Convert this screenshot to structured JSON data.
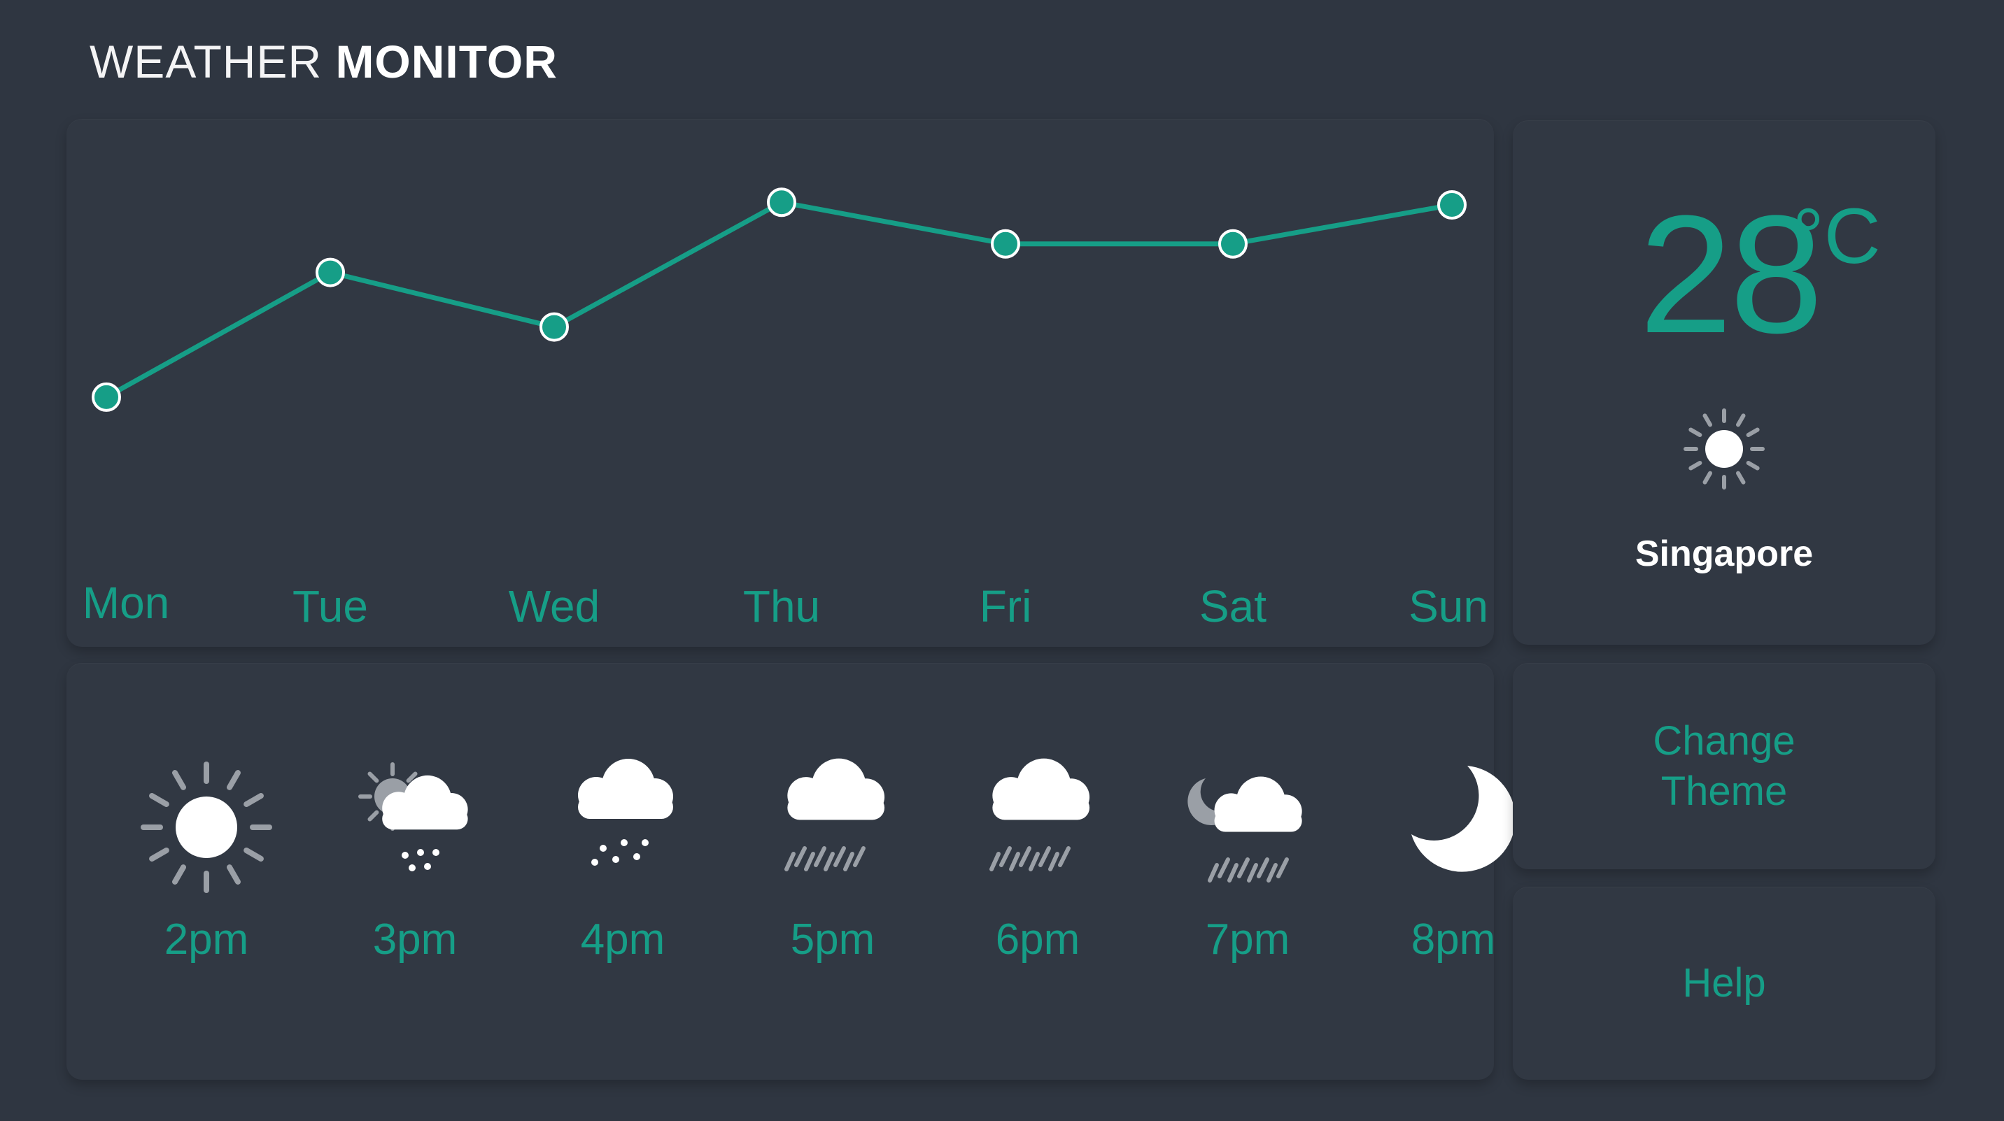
{
  "header": {
    "title_light": "WEATHER",
    "title_bold": "MONITOR"
  },
  "colors": {
    "accent": "#169e87",
    "background": "#2f3641",
    "panel": "#313843",
    "icon_white": "#ffffff",
    "icon_grey": "#9a9fa6"
  },
  "chart_data": {
    "type": "line",
    "categories": [
      "Mon",
      "Tue",
      "Wed",
      "Thu",
      "Fri",
      "Sat",
      "Sun"
    ],
    "values": [
      20.5,
      25.3,
      23.2,
      28.0,
      26.4,
      26.4,
      27.9
    ],
    "title": "",
    "xlabel": "",
    "ylabel": "",
    "ylim": [
      16,
      30
    ],
    "grid": false,
    "legend": "none"
  },
  "current": {
    "temperature": "28",
    "unit": "°C",
    "icon": "sun-icon",
    "city": "Singapore"
  },
  "hourly": [
    {
      "time": "2pm",
      "icon": "sun-icon"
    },
    {
      "time": "3pm",
      "icon": "partly-cloudy-snow-icon"
    },
    {
      "time": "4pm",
      "icon": "snow-cloud-icon"
    },
    {
      "time": "5pm",
      "icon": "rain-cloud-icon"
    },
    {
      "time": "6pm",
      "icon": "rain-cloud-icon"
    },
    {
      "time": "7pm",
      "icon": "night-rain-icon"
    },
    {
      "time": "8pm",
      "icon": "moon-icon"
    }
  ],
  "actions": {
    "change_theme_label": "Change\nTheme",
    "help_label": "Help"
  }
}
